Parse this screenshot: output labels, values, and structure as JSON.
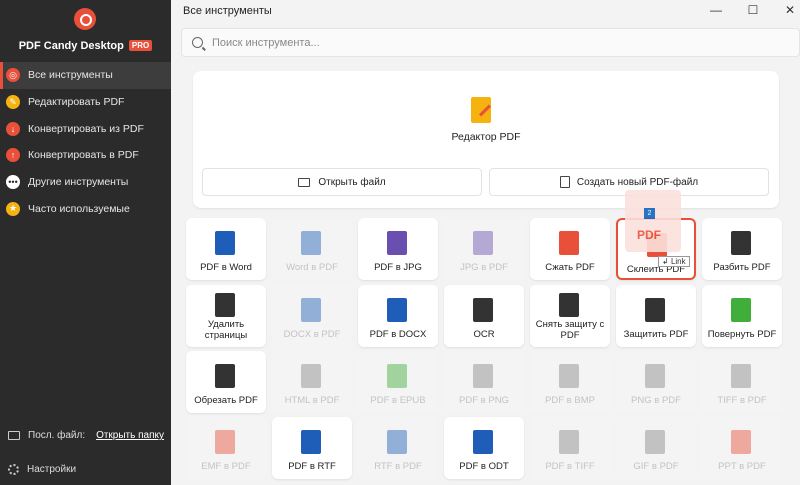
{
  "sidebar": {
    "brand": "PDF Candy Desktop",
    "pro_badge": "PRO",
    "items": [
      {
        "label": "Все инструменты",
        "icon": "target-icon",
        "color": "#e8503a"
      },
      {
        "label": "Редактировать PDF",
        "icon": "pencil-icon",
        "color": "#f6b20f"
      },
      {
        "label": "Конвертировать из PDF",
        "icon": "arrow-down-icon",
        "color": "#e8503a"
      },
      {
        "label": "Конвертировать в PDF",
        "icon": "arrow-up-icon",
        "color": "#e8503a"
      },
      {
        "label": "Другие инструменты",
        "icon": "more-icon",
        "color": "#ffffff"
      },
      {
        "label": "Часто используемые",
        "icon": "star-icon",
        "color": "#f6b20f"
      }
    ],
    "recent_label": "Посл. файл:",
    "open_folder": "Открыть папку",
    "settings": "Настройки"
  },
  "header": {
    "title": "Все инструменты",
    "minimize": "—",
    "maximize": "☐",
    "close": "✕"
  },
  "search": {
    "placeholder": "Поиск инструмента..."
  },
  "editor": {
    "label": "Редактор PDF",
    "open_file": "Открыть файл",
    "new_pdf": "Создать новый PDF-файл"
  },
  "tiles": [
    {
      "label": "PDF в Word",
      "color": "#1e5eb8"
    },
    {
      "label": "Word в PDF",
      "color": "#1e5eb8",
      "ghost": true
    },
    {
      "label": "PDF в JPG",
      "color": "#6a4fb0"
    },
    {
      "label": "JPG в PDF",
      "color": "#6a4fb0",
      "ghost": true
    },
    {
      "label": "Сжать PDF",
      "color": "#e8503a"
    },
    {
      "label": "Склеить PDF",
      "color": "#e8503a"
    },
    {
      "label": "Разбить PDF",
      "color": "#333333"
    },
    {
      "label": "Удалить страницы",
      "color": "#333333"
    },
    {
      "label": "DOCX в PDF",
      "color": "#1e5eb8",
      "ghost": true
    },
    {
      "label": "PDF в DOCX",
      "color": "#1e5eb8"
    },
    {
      "label": "OCR",
      "color": "#333333"
    },
    {
      "label": "Снять защиту с PDF",
      "color": "#333333"
    },
    {
      "label": "Защитить PDF",
      "color": "#333333"
    },
    {
      "label": "Повернуть PDF",
      "color": "#3fae3a"
    },
    {
      "label": "Обрезать PDF",
      "color": "#333333"
    },
    {
      "label": "HTML в PDF",
      "color": "#888888",
      "ghost": true
    },
    {
      "label": "PDF в EPUB",
      "color": "#3fae3a",
      "ghost": true
    },
    {
      "label": "PDF в PNG",
      "color": "#888888",
      "ghost": true
    },
    {
      "label": "PDF в BMP",
      "color": "#888888",
      "ghost": true
    },
    {
      "label": "PNG в PDF",
      "color": "#888888",
      "ghost": true
    },
    {
      "label": "TIFF в PDF",
      "color": "#888888",
      "ghost": true
    },
    {
      "label": "EMF в PDF",
      "color": "#e8503a",
      "ghost": true
    },
    {
      "label": "PDF в RTF",
      "color": "#1e5eb8"
    },
    {
      "label": "RTF в PDF",
      "color": "#1e5eb8",
      "ghost": true
    },
    {
      "label": "PDF в ODT",
      "color": "#1e5eb8"
    },
    {
      "label": "PDF в TIFF",
      "color": "#888888",
      "ghost": true
    },
    {
      "label": "GIF в PDF",
      "color": "#888888",
      "ghost": true
    },
    {
      "label": "PPT в PDF",
      "color": "#e8503a",
      "ghost": true
    }
  ],
  "drag": {
    "badge": "2",
    "text": "PDF",
    "tooltip": "Link"
  }
}
